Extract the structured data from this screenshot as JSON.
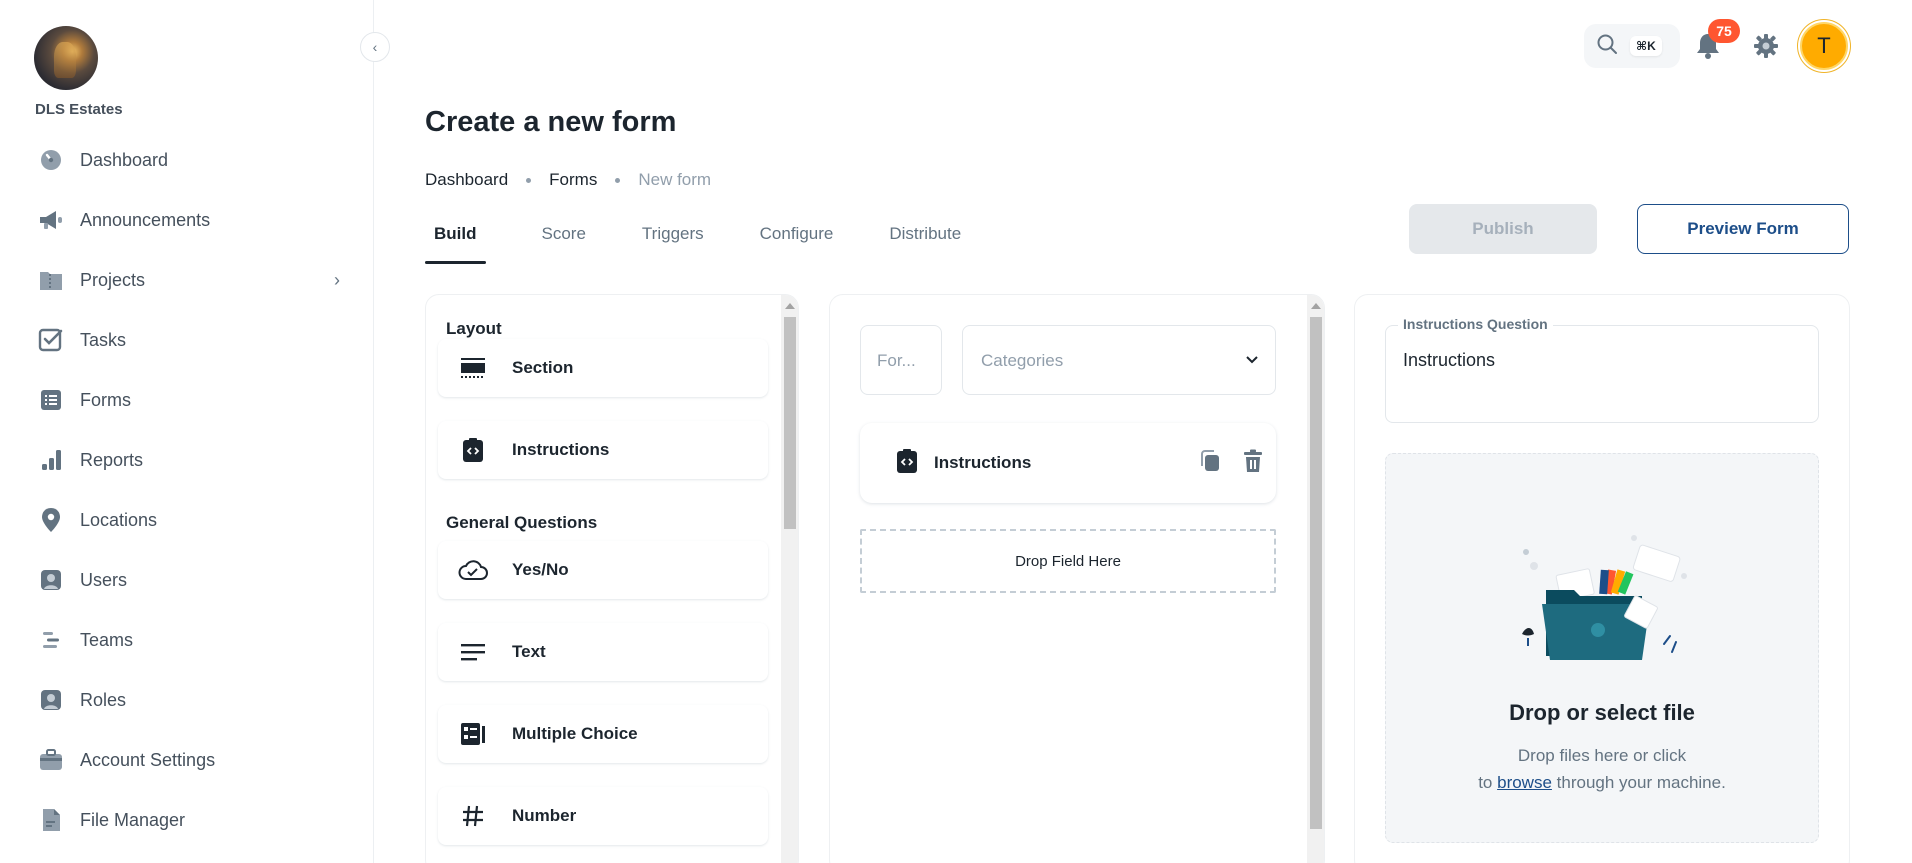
{
  "org": {
    "name": "DLS Estates"
  },
  "sidebar": {
    "items": [
      {
        "label": "Dashboard",
        "icon": "dashboard-icon"
      },
      {
        "label": "Announcements",
        "icon": "megaphone-icon"
      },
      {
        "label": "Projects",
        "icon": "folder-icon",
        "has_children": true
      },
      {
        "label": "Tasks",
        "icon": "checkbox-icon"
      },
      {
        "label": "Forms",
        "icon": "list-icon"
      },
      {
        "label": "Reports",
        "icon": "bar-chart-icon"
      },
      {
        "label": "Locations",
        "icon": "map-pin-icon"
      },
      {
        "label": "Users",
        "icon": "user-icon"
      },
      {
        "label": "Teams",
        "icon": "teams-icon"
      },
      {
        "label": "Roles",
        "icon": "user-badge-icon"
      },
      {
        "label": "Account Settings",
        "icon": "briefcase-icon"
      },
      {
        "label": "File Manager",
        "icon": "file-icon"
      }
    ]
  },
  "header": {
    "search_shortcut": "⌘K",
    "notification_count": "75",
    "user_initial": "T"
  },
  "page": {
    "title": "Create a new form",
    "breadcrumb": [
      "Dashboard",
      "Forms",
      "New form"
    ]
  },
  "tabs": [
    "Build",
    "Score",
    "Triggers",
    "Configure",
    "Distribute"
  ],
  "active_tab": "Build",
  "actions": {
    "publish": "Publish",
    "preview": "Preview Form"
  },
  "palette": {
    "groups": [
      {
        "title": "Layout",
        "items": [
          {
            "label": "Section",
            "icon": "section-icon"
          },
          {
            "label": "Instructions",
            "icon": "code-clipboard-icon"
          }
        ]
      },
      {
        "title": "General Questions",
        "items": [
          {
            "label": "Yes/No",
            "icon": "cloud-check-icon"
          },
          {
            "label": "Text",
            "icon": "text-lines-icon"
          },
          {
            "label": "Multiple Choice",
            "icon": "checklist-icon"
          },
          {
            "label": "Number",
            "icon": "hash-icon"
          }
        ]
      }
    ]
  },
  "canvas": {
    "form_name_placeholder": "For...",
    "categories_placeholder": "Categories",
    "field_label": "Instructions",
    "drop_zone": "Drop Field Here"
  },
  "properties": {
    "question_label": "Instructions Question",
    "question_value": "Instructions",
    "upload_title": "Drop or select file",
    "upload_line1": "Drop files here or click",
    "upload_line2_prefix": "to",
    "upload_link": "browse",
    "upload_line2_suffix": "through your machine."
  },
  "colors": {
    "primary": "#1d4e89",
    "text": "#1c252e",
    "muted": "#637381",
    "badge": "#ff5630",
    "avatar": "#ffab00",
    "disabled_bg": "#e5e8eb"
  }
}
